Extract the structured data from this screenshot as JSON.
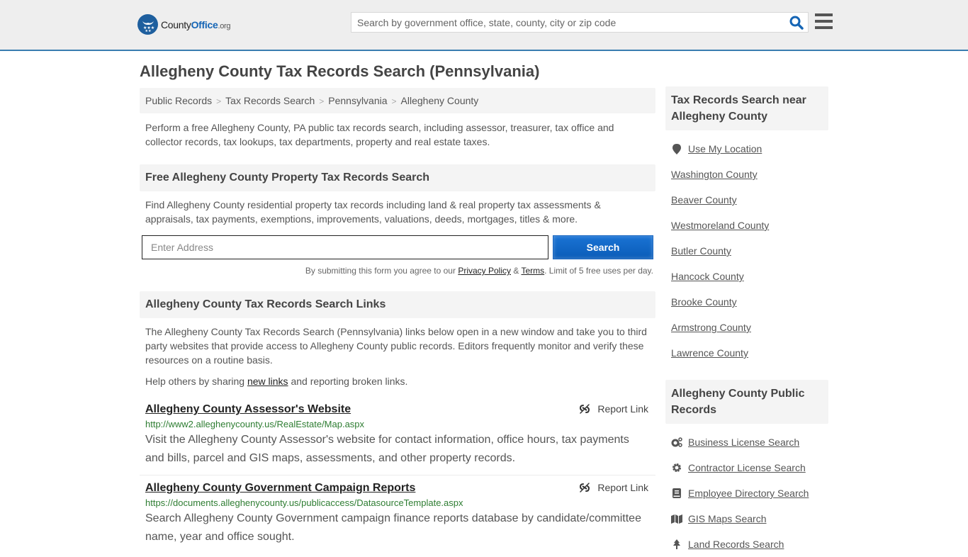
{
  "header": {
    "logo": {
      "county": "County",
      "office": "Office",
      "org": ".org"
    },
    "search_placeholder": "Search by government office, state, county, city or zip code",
    "search_icon": "magnifier-icon",
    "menu_icon": "hamburger-icon"
  },
  "page": {
    "title": "Allegheny County Tax Records Search (Pennsylvania)"
  },
  "breadcrumb": [
    {
      "label": "Public Records"
    },
    {
      "label": "Tax Records Search"
    },
    {
      "label": "Pennsylvania"
    },
    {
      "label": "Allegheny County"
    }
  ],
  "breadcrumb_separator": ">",
  "intro": "Perform a free Allegheny County, PA public tax records search, including assessor, treasurer, tax office and collector records, tax lookups, tax departments, property and real estate taxes.",
  "property_search": {
    "heading": "Free Allegheny County Property Tax Records Search",
    "description": "Find Allegheny County residential property tax records including land & real property tax assessments & appraisals, tax payments, exemptions, improvements, valuations, deeds, mortgages, titles & more.",
    "address_placeholder": "Enter Address",
    "button_label": "Search",
    "disclaimer_prefix": "By submitting this form you agree to our ",
    "privacy_label": "Privacy Policy",
    "amp": " & ",
    "terms_label": "Terms",
    "disclaimer_suffix": ". Limit of 5 free uses per day."
  },
  "links_section": {
    "heading": "Allegheny County Tax Records Search Links",
    "description": "The Allegheny County Tax Records Search (Pennsylvania) links below open in a new window and take you to third party websites that provide access to Allegheny County public records. Editors frequently monitor and verify these resources on a routine basis.",
    "help_prefix": "Help others by sharing ",
    "help_link": "new links",
    "help_suffix": " and reporting broken links.",
    "report_label": "Report Link",
    "items": [
      {
        "title": "Allegheny County Assessor's Website",
        "url": "http://www2.alleghenycounty.us/RealEstate/Map.aspx",
        "description": "Visit the Allegheny County Assessor's website for contact information, office hours, tax payments and bills, parcel and GIS maps, assessments, and other property records."
      },
      {
        "title": "Allegheny County Government Campaign Reports",
        "url": "https://documents.alleghenycounty.us/publicaccess/DatasourceTemplate.aspx",
        "description": "Search Allegheny County Government campaign finance reports database by candidate/committee name, year and office sought."
      }
    ]
  },
  "sidebar": {
    "nearby": {
      "heading": "Tax Records Search near Allegheny County",
      "use_location": "Use My Location",
      "counties": [
        "Washington County",
        "Beaver County",
        "Westmoreland County",
        "Butler County",
        "Hancock County",
        "Brooke County",
        "Armstrong County",
        "Lawrence County"
      ]
    },
    "public_records": {
      "heading": "Allegheny County Public Records",
      "items": [
        {
          "label": "Business License Search",
          "icon": "cogs-icon"
        },
        {
          "label": "Contractor License Search",
          "icon": "gear-icon"
        },
        {
          "label": "Employee Directory Search",
          "icon": "book-icon"
        },
        {
          "label": "GIS Maps Search",
          "icon": "map-icon"
        },
        {
          "label": "Land Records Search",
          "icon": "tree-icon"
        }
      ]
    }
  },
  "colors": {
    "brand_blue": "#1e5f9e",
    "accent_bar": "#3a7db0",
    "button_blue": "#0a5cb8",
    "url_green": "#2e7d32"
  }
}
